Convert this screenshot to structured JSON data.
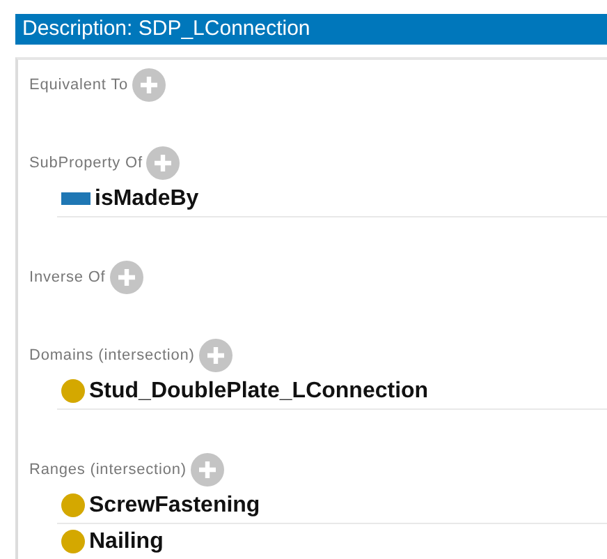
{
  "title": "Description: SDP_LConnection",
  "sections": [
    {
      "label": "Equivalent To"
    },
    {
      "label": "SubProperty Of",
      "items": [
        {
          "kind": "property",
          "name": "isMadeBy"
        }
      ]
    },
    {
      "label": "Inverse Of"
    },
    {
      "label": "Domains (intersection)",
      "items": [
        {
          "kind": "class",
          "name": "Stud_DoublePlate_LConnection"
        }
      ]
    },
    {
      "label": "Ranges (intersection)",
      "items": [
        {
          "kind": "class",
          "name": "ScrewFastening"
        },
        {
          "kind": "class",
          "name": "Nailing"
        }
      ]
    }
  ]
}
